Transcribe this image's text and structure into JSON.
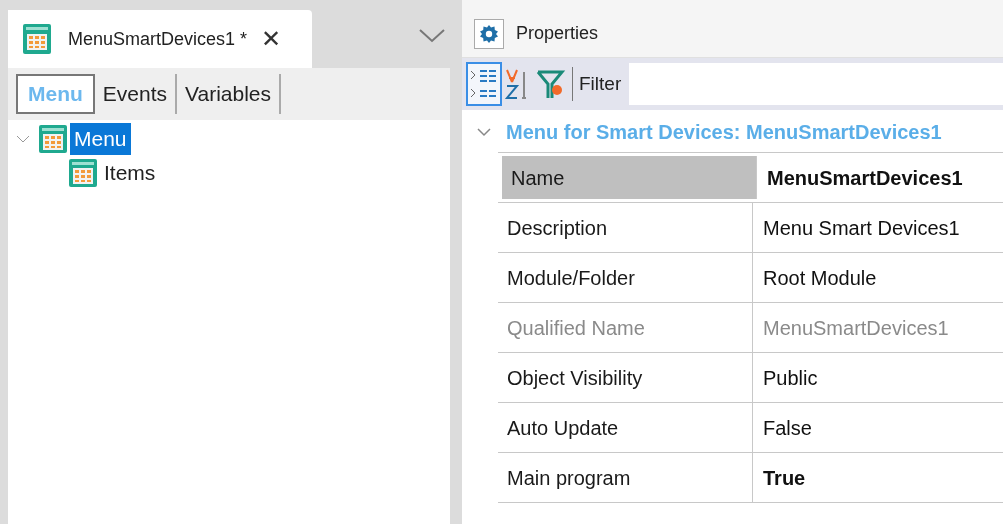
{
  "document_tab": {
    "title": "MenuSmartDevices1 *",
    "close": "✕"
  },
  "view_tabs": [
    {
      "label": "Menu",
      "selected": true
    },
    {
      "label": "Events",
      "selected": false
    },
    {
      "label": "Variables",
      "selected": false
    }
  ],
  "tree": [
    {
      "label": "Menu",
      "selected": true,
      "expanded": true,
      "children": [
        {
          "label": "Items",
          "selected": false
        }
      ]
    }
  ],
  "properties": {
    "title": "Properties",
    "toolbar": {
      "categorized_selected": true,
      "filter_label": "Filter"
    },
    "group": {
      "title": "Menu for Smart Devices: MenuSmartDevices1",
      "expanded": true
    },
    "rows": [
      {
        "name": "Name",
        "value": "MenuSmartDevices1",
        "selected": true,
        "bold": true,
        "disabled": false
      },
      {
        "name": "Description",
        "value": "Menu Smart Devices1",
        "selected": false,
        "bold": false,
        "disabled": false
      },
      {
        "name": "Module/Folder",
        "value": "Root Module",
        "selected": false,
        "bold": false,
        "disabled": false
      },
      {
        "name": "Qualified Name",
        "value": "MenuSmartDevices1",
        "selected": false,
        "bold": false,
        "disabled": true
      },
      {
        "name": "Object Visibility",
        "value": "Public",
        "selected": false,
        "bold": false,
        "disabled": false
      },
      {
        "name": "Auto Update",
        "value": "False",
        "selected": false,
        "bold": false,
        "disabled": false
      },
      {
        "name": "Main program",
        "value": "True",
        "selected": false,
        "bold": true,
        "disabled": false
      }
    ]
  }
}
